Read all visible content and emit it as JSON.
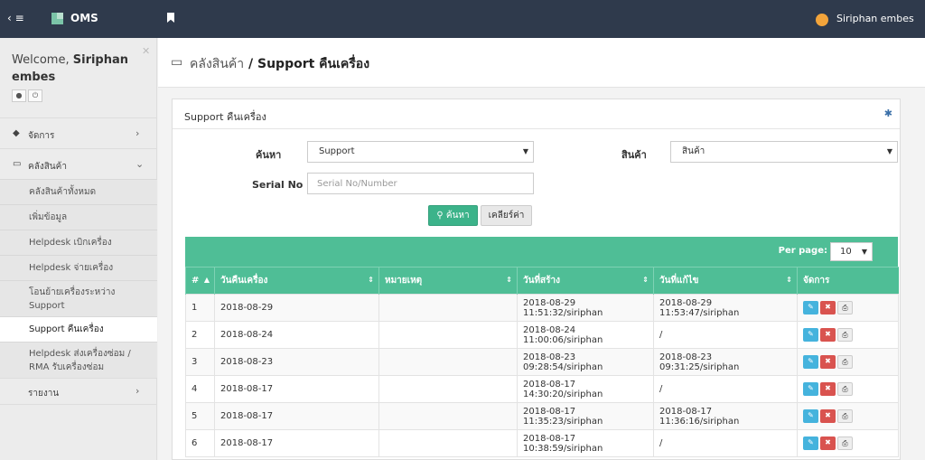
{
  "topbar": {
    "toggle": "‹ ≡",
    "brand": "OMS",
    "user": "Siriphan embes"
  },
  "sidebar": {
    "welcome": "Welcome,",
    "username": "Siriphan embes",
    "menu": [
      {
        "label": "จัดการ"
      },
      {
        "label": "คลังสินค้า"
      }
    ],
    "sub_items": [
      {
        "label": "คลังสินค้าทั้งหมด"
      },
      {
        "label": "เพิ่มข้อมูล"
      },
      {
        "label": "Helpdesk เบิกเครื่อง"
      },
      {
        "label": "Helpdesk จ่ายเครื่อง"
      },
      {
        "label": "โอนย้ายเครื่องระหว่าง Support"
      },
      {
        "label": "Support คืนเครื่อง"
      },
      {
        "label": "Helpdesk ส่งเครื่องซ่อม / RMA รับเครื่องซ่อม"
      }
    ],
    "report": {
      "label": "รายงาน"
    }
  },
  "page": {
    "crumb_parent": "คลังสินค้า",
    "crumb_sep": " / ",
    "crumb_current": "Support คืนเครื่อง"
  },
  "panel": {
    "title": "Support คืนเครื่อง"
  },
  "filters": {
    "search_label": "ค้นหา",
    "search_value": "Support",
    "product_label": "สินค้า",
    "product_value": "สินค้า",
    "serial_label": "Serial No",
    "serial_placeholder": "Serial No/Number",
    "search_button": "ค้นหา",
    "clear_button": "เคลียร์ค่า"
  },
  "grid": {
    "per_page_label": "Per page:",
    "per_page_value": "10",
    "headers": [
      "#",
      "วันคืนเครื่อง",
      "หมายเหตุ",
      "วันที่สร้าง",
      "วันที่แก้ไข",
      "จัดการ"
    ],
    "rows": [
      {
        "no": "1",
        "return_date": "2018-08-29",
        "note": "",
        "created": "2018-08-29 11:51:32/siriphan",
        "updated": "2018-08-29 11:53:47/siriphan"
      },
      {
        "no": "2",
        "return_date": "2018-08-24",
        "note": "",
        "created": "2018-08-24 11:00:06/siriphan",
        "updated": "/"
      },
      {
        "no": "3",
        "return_date": "2018-08-23",
        "note": "",
        "created": "2018-08-23 09:28:54/siriphan",
        "updated": "2018-08-23 09:31:25/siriphan"
      },
      {
        "no": "4",
        "return_date": "2018-08-17",
        "note": "",
        "created": "2018-08-17 14:30:20/siriphan",
        "updated": "/"
      },
      {
        "no": "5",
        "return_date": "2018-08-17",
        "note": "",
        "created": "2018-08-17 11:35:23/siriphan",
        "updated": "2018-08-17 11:36:16/siriphan"
      },
      {
        "no": "6",
        "return_date": "2018-08-17",
        "note": "",
        "created": "2018-08-17 10:38:59/siriphan",
        "updated": "/"
      }
    ]
  },
  "colors": {
    "topbar": "#2f3a4c",
    "accent": "#4fbe96",
    "edit": "#45b3dd",
    "delete": "#d9534f"
  }
}
